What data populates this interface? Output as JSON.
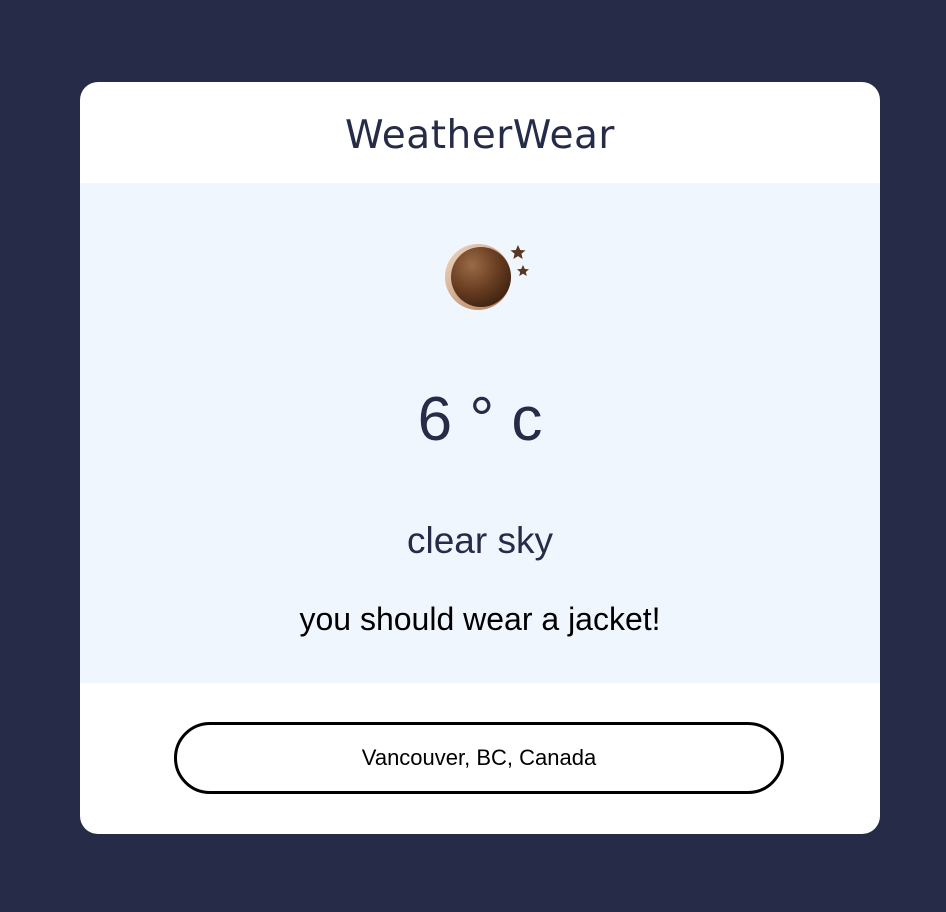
{
  "app": {
    "title": "WeatherWear"
  },
  "weather": {
    "icon": "moon-stars-icon",
    "temperature": "6 ° c",
    "description": "clear sky",
    "advice": "you should wear a jacket!"
  },
  "location": {
    "value": "Vancouver, BC, Canada"
  },
  "colors": {
    "background": "#262c48",
    "card": "#ffffff",
    "panel": "#f0f6fe",
    "text_primary": "#262c48",
    "moon": "#6b3f22"
  }
}
